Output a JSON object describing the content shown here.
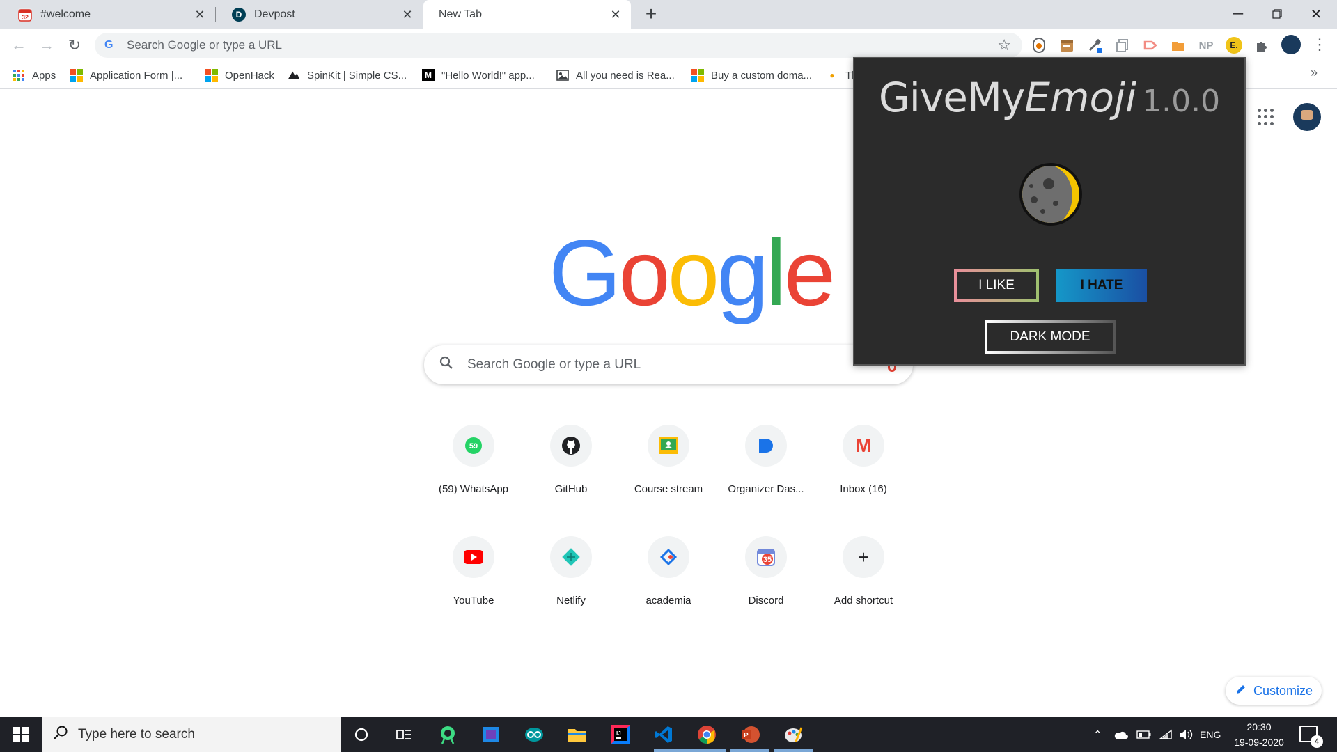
{
  "tabs": [
    {
      "title": "#welcome",
      "favicon": "discord-badge-icon",
      "badge": "32"
    },
    {
      "title": "Devpost",
      "favicon": "devpost-icon",
      "letter": "D"
    },
    {
      "title": "New Tab",
      "active": true
    }
  ],
  "toolbar": {
    "omnibox_placeholder": "Search Google or type a URL",
    "extensions": [
      "grammarly-icon",
      "archive-icon",
      "eyedropper-icon",
      "copy-icon",
      "arrow-ext-icon",
      "folder-ext-icon",
      "NP",
      "E.",
      "puzzle-icon"
    ],
    "np_label": "NP",
    "e_label": "E."
  },
  "bookmarks": [
    {
      "label": "Apps",
      "icon": "apps-grid-icon"
    },
    {
      "label": "Application Form |...",
      "icon": "microsoft-icon"
    },
    {
      "label": "OpenHack",
      "icon": "microsoft-icon"
    },
    {
      "label": "SpinKit | Simple CS...",
      "icon": "spinkit-icon"
    },
    {
      "label": "\"Hello World!\" app...",
      "icon": "medium-icon",
      "letter": "M"
    },
    {
      "label": "All you need is Rea...",
      "icon": "image-icon"
    },
    {
      "label": "Buy a custom doma...",
      "icon": "microsoft-icon"
    },
    {
      "label": "Th",
      "icon": "bulb-icon"
    }
  ],
  "ntp": {
    "logo": [
      "G",
      "o",
      "o",
      "g",
      "l",
      "e"
    ],
    "search_placeholder": "Search Google or type a URL",
    "shortcuts_row1": [
      {
        "label": "(59) WhatsApp",
        "icon": "whatsapp-icon",
        "badge": "59"
      },
      {
        "label": "GitHub",
        "icon": "github-icon"
      },
      {
        "label": "Course stream",
        "icon": "classroom-icon"
      },
      {
        "label": "Organizer Das...",
        "icon": "devpost-organizer-icon"
      },
      {
        "label": "Inbox (16)",
        "icon": "gmail-icon",
        "letter": "M"
      }
    ],
    "shortcuts_row2": [
      {
        "label": "YouTube",
        "icon": "youtube-icon"
      },
      {
        "label": "Netlify",
        "icon": "netlify-icon"
      },
      {
        "label": "academia",
        "icon": "academia-icon"
      },
      {
        "label": "Discord",
        "icon": "discord-calendar-icon",
        "badge": "35"
      },
      {
        "label": "Add shortcut",
        "icon": "plus-icon",
        "glyph": "+"
      }
    ],
    "customize_label": "Customize"
  },
  "popup": {
    "title_name": "GiveMy",
    "title_emph": "Emoji",
    "version": "1.0.0",
    "emoji": "moon-icon",
    "like_label": "I LIKE",
    "hate_label": "I HATE",
    "dark_mode_label": "DARK MODE"
  },
  "taskbar": {
    "search_placeholder": "Type here to search",
    "apps": [
      "cortana-icon",
      "task-view-icon",
      "android-studio-icon",
      "3d-viewer-icon",
      "arduino-icon",
      "file-explorer-icon",
      "intellij-icon",
      "vscode-icon",
      "chrome-icon",
      "powerpoint-icon",
      "paint-icon"
    ],
    "lang": "ENG",
    "time": "20:30",
    "date": "19-09-2020",
    "notifications": "4"
  },
  "colors": {
    "google_blue": "#4285f4",
    "google_red": "#ea4335",
    "google_yellow": "#fbbc05",
    "google_green": "#34a853",
    "popup_bg": "#2b2b2b",
    "hate_gradient_start": "#1597c8",
    "hate_gradient_end": "#1a4fa3"
  }
}
